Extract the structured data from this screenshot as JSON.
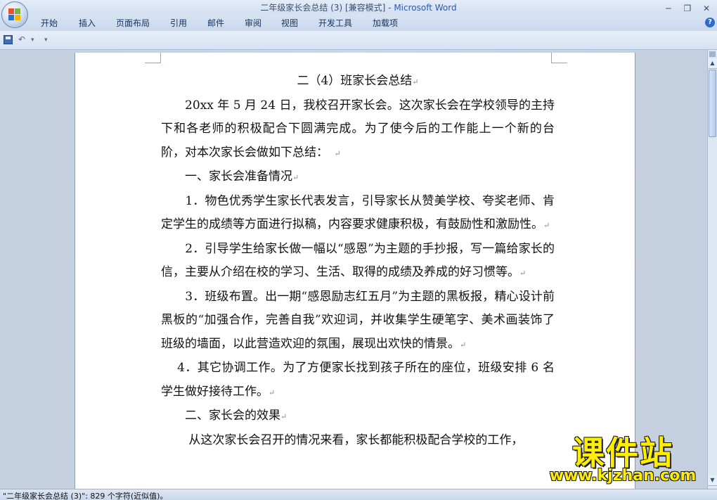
{
  "window": {
    "title_doc": "二年级家长会总结 (3) [兼容模式] - ",
    "title_app": "Microsoft Word",
    "controls": {
      "minimize": "─",
      "restore": "❐",
      "close": "✕"
    }
  },
  "ribbon": {
    "tabs": [
      "开始",
      "插入",
      "页面布局",
      "引用",
      "邮件",
      "审阅",
      "视图",
      "开发工具",
      "加载项"
    ],
    "help": "?"
  },
  "quick_access": {
    "undo": "↶",
    "dropdown1": "▾",
    "customize": "▾"
  },
  "document": {
    "title": "二（4）班家长会总结",
    "paragraphs": [
      "　　20xx 年 5 月 24 日，我校召开家长会。这次家长会在学校领导的主持下和各老师的积极配合下圆满完成。为了使今后的工作能上一个新的台阶，对本次家长会做如下总结：　",
      "　　一、家长会准备情况",
      "　　1．物色优秀学生家长代表发言，引导家长从赞美学校、夸奖老师、肯定学生的成绩等方面进行拟稿，内容要求健康积极，有鼓励性和激励性。",
      "　　2．引导学生给家长做一幅以“感恩”为主题的手抄报，写一篇给家长的信，主要从介绍在校的学习、生活、取得的成绩及养成的好习惯等。",
      "　　3．班级布置。出一期“感恩励志红五月”为主题的黑板报，精心设计前黑板的“加强合作，完善自我”欢迎词，并收集学生硬笔字、美术画装饰了班级的墙面，以此营造欢迎的氛围，展现出欢快的情景。",
      "　 4．其它协调工作。为了方便家长找到孩子所在的座位，班级安排 6 名学生做好接待工作。",
      "　　二、家长会的效果",
      "　　 从这次家长会召开的情况来看，家长都能积极配合学校的工作，"
    ],
    "paragraph_mark": "↵"
  },
  "scrollbar": {
    "up": "▲",
    "down": "▼"
  },
  "status_bar": {
    "text": "\"二年级家长会总结 (3)\": 829 个字符(近似值)。"
  },
  "watermark": {
    "text_cn": "课件站",
    "url": "www.kjzhan.com"
  },
  "colors": {
    "accent": "#2e5aa8",
    "watermark": "#ffee00"
  }
}
